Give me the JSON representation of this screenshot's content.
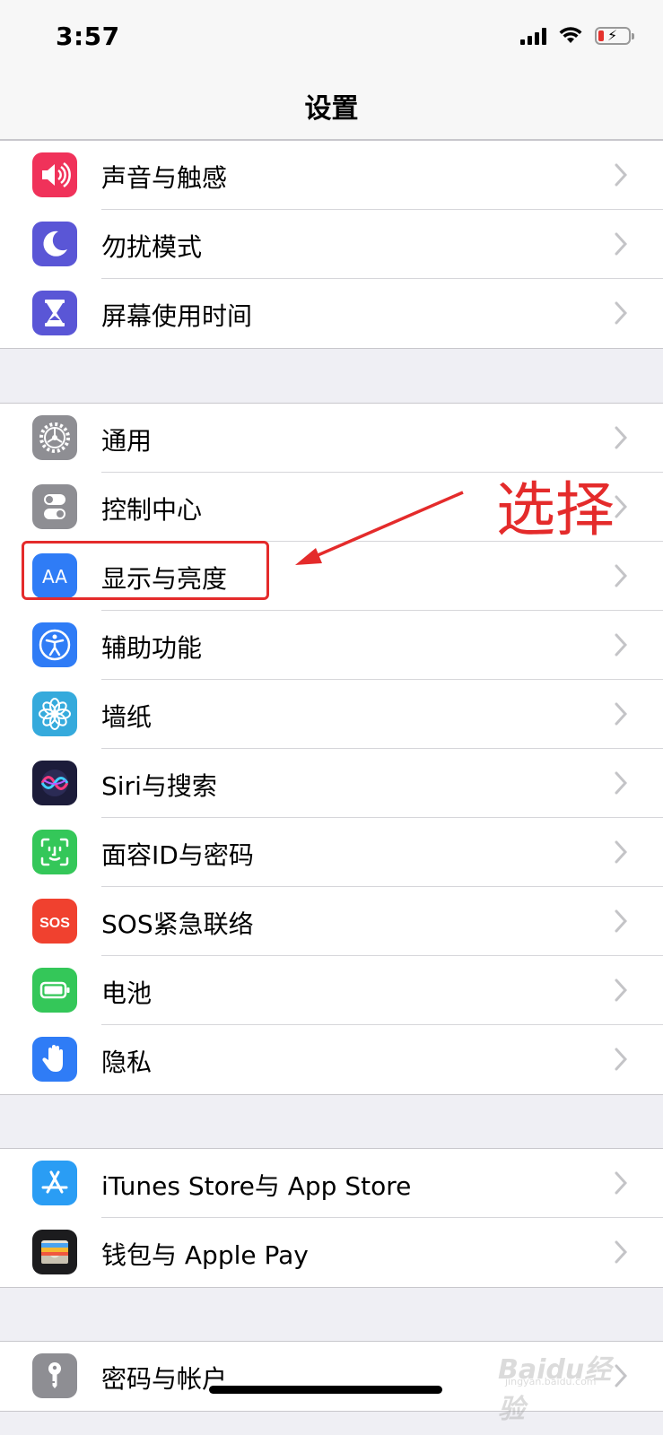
{
  "status_bar": {
    "time": "3:57",
    "signal_icon": "cellular-signal-icon",
    "wifi_icon": "wifi-icon",
    "battery_icon": "battery-charging-icon"
  },
  "nav": {
    "title": "设置"
  },
  "groups": [
    {
      "items": [
        {
          "label": "声音与触感",
          "icon": "speaker-icon",
          "color": "#f0325a"
        },
        {
          "label": "勿扰模式",
          "icon": "moon-icon",
          "color": "#5a56d6"
        },
        {
          "label": "屏幕使用时间",
          "icon": "hourglass-icon",
          "color": "#5a56d6"
        }
      ]
    },
    {
      "items": [
        {
          "label": "通用",
          "icon": "gear-icon",
          "color": "#8e8e93"
        },
        {
          "label": "控制中心",
          "icon": "toggle-switches-icon",
          "color": "#8e8e93"
        },
        {
          "label": "显示与亮度",
          "icon": "text-size-aa-icon",
          "icon_text": "AA",
          "color": "#2f7cf6"
        },
        {
          "label": "辅助功能",
          "icon": "accessibility-icon",
          "color": "#2f7cf6"
        },
        {
          "label": "墙纸",
          "icon": "flower-icon",
          "color": "#35aadc"
        },
        {
          "label": "Siri与搜索",
          "icon": "siri-icon",
          "color": "#1c1c3a"
        },
        {
          "label": "面容ID与密码",
          "icon": "face-id-icon",
          "color": "#34c759"
        },
        {
          "label": "SOS紧急联络",
          "icon": "sos-icon",
          "icon_text": "SOS",
          "color": "#f0412f"
        },
        {
          "label": "电池",
          "icon": "battery-icon",
          "color": "#34c759"
        },
        {
          "label": "隐私",
          "icon": "hand-icon",
          "color": "#2f7cf6"
        }
      ]
    },
    {
      "items": [
        {
          "label": "iTunes Store与 App Store",
          "icon": "app-store-icon",
          "color": "#2a9df4"
        },
        {
          "label": "钱包与 Apple Pay",
          "icon": "wallet-icon",
          "color": "#1c1c1e"
        }
      ]
    },
    {
      "items": [
        {
          "label": "密码与帐户",
          "icon": "key-icon",
          "color": "#8e8e93"
        }
      ]
    }
  ],
  "annotation": {
    "text": "选择",
    "color": "#e42b2b"
  },
  "watermark": {
    "line1": "Baidu经验",
    "line2": "jingyan.baidu.com"
  }
}
